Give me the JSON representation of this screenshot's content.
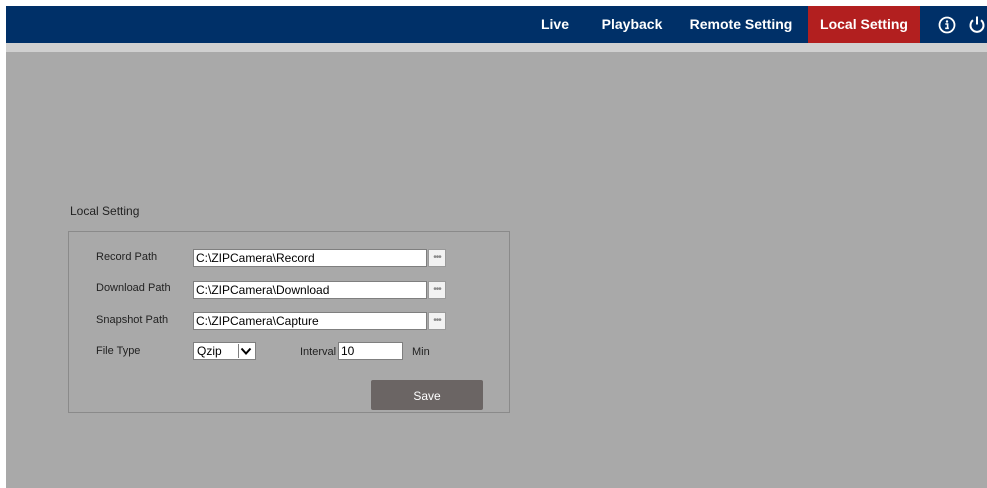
{
  "nav": {
    "items": [
      {
        "label": "Live",
        "active": false
      },
      {
        "label": "Playback",
        "active": false
      },
      {
        "label": "Remote Setting",
        "active": false
      },
      {
        "label": "Local Setting",
        "active": true
      }
    ],
    "icons": [
      "info-icon",
      "power-icon"
    ]
  },
  "colors": {
    "nav_background": "#003068",
    "active_tab": "#b21f1f",
    "content_background": "#a9a9a9",
    "save_button": "#6b6564"
  },
  "local_setting": {
    "title": "Local Setting",
    "record_path": {
      "label": "Record Path",
      "value": "C:\\ZIPCamera\\Record",
      "browse_label": "•••"
    },
    "download_path": {
      "label": "Download Path",
      "value": "C:\\ZIPCamera\\Download",
      "browse_label": "•••"
    },
    "snapshot_path": {
      "label": "Snapshot Path",
      "value": "C:\\ZIPCamera\\Capture",
      "browse_label": "•••"
    },
    "file_type": {
      "label": "File Type",
      "value": "Qzip"
    },
    "interval": {
      "label": "Interval",
      "value": "10",
      "unit": "Min"
    },
    "save_label": "Save"
  }
}
